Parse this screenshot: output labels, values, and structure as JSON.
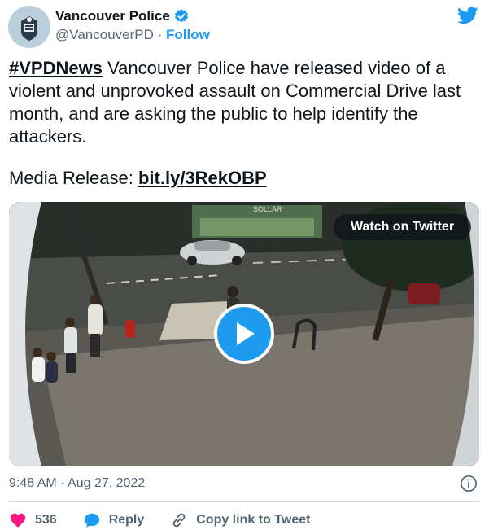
{
  "account": {
    "name": "Vancouver Police",
    "handle": "@VancouverPD",
    "separator": " · ",
    "follow_label": "Follow"
  },
  "tweet": {
    "hashtag": "#VPDNews",
    "text": " Vancouver Police have released video of a violent and unprovoked assault on Commercial Drive last month, and are asking the public to help identify the attackers.",
    "release_label": "Media Release: ",
    "release_link": "bit.ly/3RekOBP"
  },
  "video": {
    "watch_label": "Watch on Twitter",
    "store_sign": "SOLLAR"
  },
  "meta": {
    "timestamp": "9:48 AM · Aug 27, 2022"
  },
  "actions": {
    "like_count": "536",
    "reply_label": "Reply",
    "copy_label": "Copy link to Tweet"
  },
  "colors": {
    "accent": "#1d9bf0",
    "like": "#f91880",
    "text": "#0f1419",
    "muted": "#536471"
  }
}
